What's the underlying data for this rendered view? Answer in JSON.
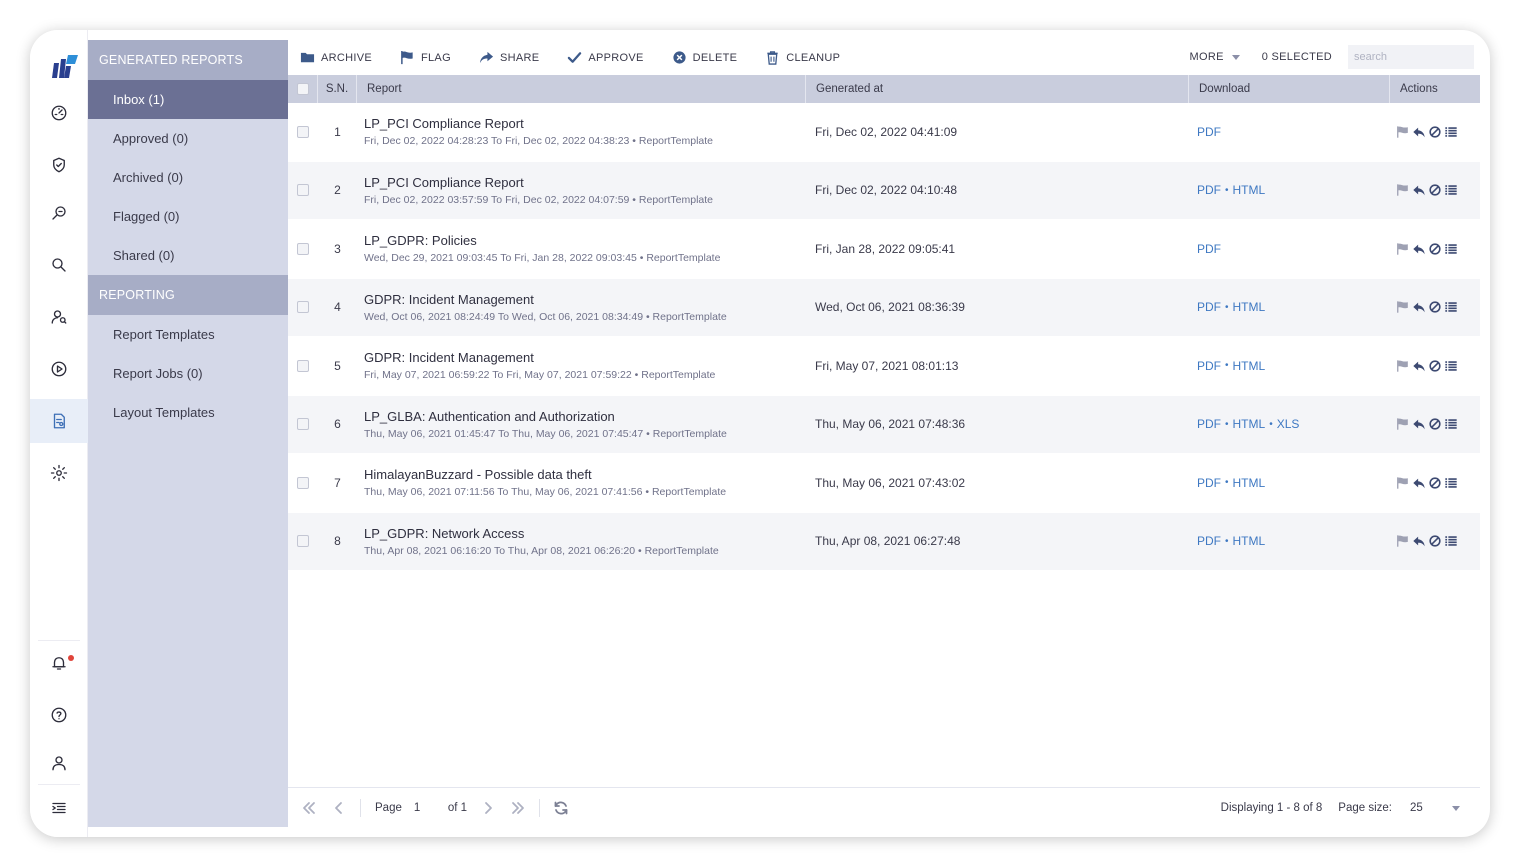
{
  "sidebar": {
    "sections": [
      {
        "title": "GENERATED REPORTS",
        "items": [
          {
            "label": "Inbox (1)",
            "active": true
          },
          {
            "label": "Approved (0)",
            "active": false
          },
          {
            "label": "Archived (0)",
            "active": false
          },
          {
            "label": "Flagged (0)",
            "active": false
          },
          {
            "label": "Shared (0)",
            "active": false
          }
        ]
      },
      {
        "title": "REPORTING",
        "items": [
          {
            "label": "Report Templates",
            "active": false
          },
          {
            "label": "Report Jobs (0)",
            "active": false
          },
          {
            "label": "Layout Templates",
            "active": false
          }
        ]
      }
    ]
  },
  "rail_icons": [
    "dashboard-icon",
    "shield-icon",
    "investigate-icon",
    "search-icon",
    "user-search-icon",
    "play-circle-icon",
    "report-icon",
    "gear-icon",
    "bell-icon",
    "help-icon",
    "user-icon",
    "menu-collapse-icon"
  ],
  "toolbar": {
    "archive": "ARCHIVE",
    "flag": "FLAG",
    "share": "SHARE",
    "approve": "APPROVE",
    "delete": "DELETE",
    "cleanup": "CLEANUP",
    "more": "MORE",
    "selected": "0 SELECTED",
    "search_placeholder": "search"
  },
  "table": {
    "columns": [
      "S.N.",
      "Report",
      "Generated at",
      "Download",
      "Actions"
    ],
    "rows": [
      {
        "sn": "1",
        "title": "LP_PCI Compliance Report",
        "sub": "Fri, Dec 02, 2022 04:28:23 To Fri, Dec 02, 2022 04:38:23 • ReportTemplate",
        "generated": "Fri, Dec 02, 2022 04:41:09",
        "downloads": [
          "PDF"
        ]
      },
      {
        "sn": "2",
        "title": "LP_PCI Compliance Report",
        "sub": "Fri, Dec 02, 2022 03:57:59 To Fri, Dec 02, 2022 04:07:59 • ReportTemplate",
        "generated": "Fri, Dec 02, 2022 04:10:48",
        "downloads": [
          "PDF",
          "HTML"
        ]
      },
      {
        "sn": "3",
        "title": "LP_GDPR: Policies",
        "sub": "Wed, Dec 29, 2021 09:03:45 To Fri, Jan 28, 2022 09:03:45 • ReportTemplate",
        "generated": "Fri, Jan 28, 2022 09:05:41",
        "downloads": [
          "PDF"
        ]
      },
      {
        "sn": "4",
        "title": "GDPR: Incident Management",
        "sub": "Wed, Oct 06, 2021 08:24:49 To Wed, Oct 06, 2021 08:34:49 • ReportTemplate",
        "generated": "Wed, Oct 06, 2021 08:36:39",
        "downloads": [
          "PDF",
          "HTML"
        ]
      },
      {
        "sn": "5",
        "title": "GDPR: Incident Management",
        "sub": "Fri, May 07, 2021 06:59:22 To Fri, May 07, 2021 07:59:22 • ReportTemplate",
        "generated": "Fri, May 07, 2021 08:01:13",
        "downloads": [
          "PDF",
          "HTML"
        ]
      },
      {
        "sn": "6",
        "title": "LP_GLBA: Authentication and Authorization",
        "sub": "Thu, May 06, 2021 01:45:47 To Thu, May 06, 2021 07:45:47 • ReportTemplate",
        "generated": "Thu, May 06, 2021 07:48:36",
        "downloads": [
          "PDF",
          "HTML",
          "XLS"
        ]
      },
      {
        "sn": "7",
        "title": "HimalayanBuzzard - Possible data theft",
        "sub": "Thu, May 06, 2021 07:11:56 To Thu, May 06, 2021 07:41:56 • ReportTemplate",
        "generated": "Thu, May 06, 2021 07:43:02",
        "downloads": [
          "PDF",
          "HTML"
        ]
      },
      {
        "sn": "8",
        "title": "LP_GDPR: Network Access",
        "sub": "Thu, Apr 08, 2021 06:16:20 To Thu, Apr 08, 2021 06:26:20 • ReportTemplate",
        "generated": "Thu, Apr 08, 2021 06:27:48",
        "downloads": [
          "PDF",
          "HTML"
        ]
      }
    ]
  },
  "pager": {
    "page_label": "Page",
    "page_value": "1",
    "of_label": "of 1",
    "displaying": "Displaying 1 - 8 of 8",
    "page_size_label": "Page size:",
    "page_size": "25"
  },
  "colors": {
    "accent_link": "#3e78c2",
    "active_nav": "#6b7094",
    "nav_bg": "#d4d8e8",
    "nav_header": "#a7adc6",
    "notification": "#e0443a"
  }
}
